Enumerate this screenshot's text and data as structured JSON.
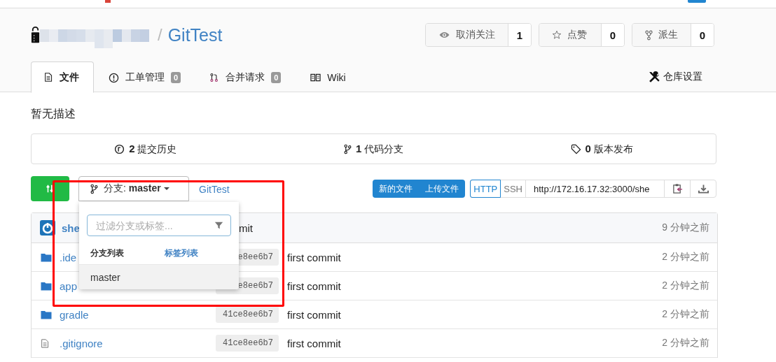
{
  "repo": {
    "separator": "/",
    "name": "GitTest"
  },
  "actions": [
    {
      "kind": "watch",
      "label": "取消关注",
      "count": "1"
    },
    {
      "kind": "star",
      "label": "点赞",
      "count": "0"
    },
    {
      "kind": "fork",
      "label": "派生",
      "count": "0"
    }
  ],
  "tabs": [
    {
      "kind": "files",
      "label": "文件",
      "selected": true
    },
    {
      "kind": "issues",
      "label": "工单管理",
      "count": "0",
      "selected": false
    },
    {
      "kind": "pulls",
      "label": "合并请求",
      "count": "0",
      "selected": false
    },
    {
      "kind": "wiki",
      "label": "Wiki",
      "selected": false
    }
  ],
  "settings": {
    "label": "仓库设置"
  },
  "description": "暂无描述",
  "summary": [
    {
      "kind": "commits",
      "count": "2",
      "label": "提交历史"
    },
    {
      "kind": "branches",
      "count": "1",
      "label": "代码分支"
    },
    {
      "kind": "releases",
      "count": "0",
      "label": "版本发布"
    }
  ],
  "toolbar": {
    "branch_label": "分支:",
    "branch": "master",
    "path": "GitTest",
    "file_buttons": [
      "新的文件",
      "上传文件"
    ],
    "protocols": [
      {
        "label": "HTTP",
        "selected": true
      },
      {
        "label": "SSH",
        "selected": false
      }
    ],
    "clone_url": "http://172.16.17.32:3000/she"
  },
  "branch_dropdown": {
    "placeholder": "过滤分支或标签...",
    "tabs": [
      {
        "label": "分支列表",
        "selected": true
      },
      {
        "label": "标签列表",
        "selected": false
      }
    ],
    "items": [
      {
        "label": "master",
        "selected": true
      }
    ]
  },
  "latest_commit": {
    "author": "she",
    "message": "mit",
    "time": "9 分钟之前"
  },
  "files": [
    {
      "kind": "folder",
      "name": ".ide",
      "sha": "e8ee6b7",
      "message": "first commit",
      "time": "2 分钟之前"
    },
    {
      "kind": "folder",
      "name": "app",
      "sha": "e8ee6b7",
      "message": "first commit",
      "time": "2 分钟之前"
    },
    {
      "kind": "folder",
      "name": "gradle",
      "sha": "41ce8ee6b7",
      "message": "first commit",
      "time": "2 分钟之前"
    },
    {
      "kind": "file",
      "name": ".gitignore",
      "sha": "41ce8ee6b7",
      "message": "first commit",
      "time": "2 分钟之前"
    }
  ]
}
